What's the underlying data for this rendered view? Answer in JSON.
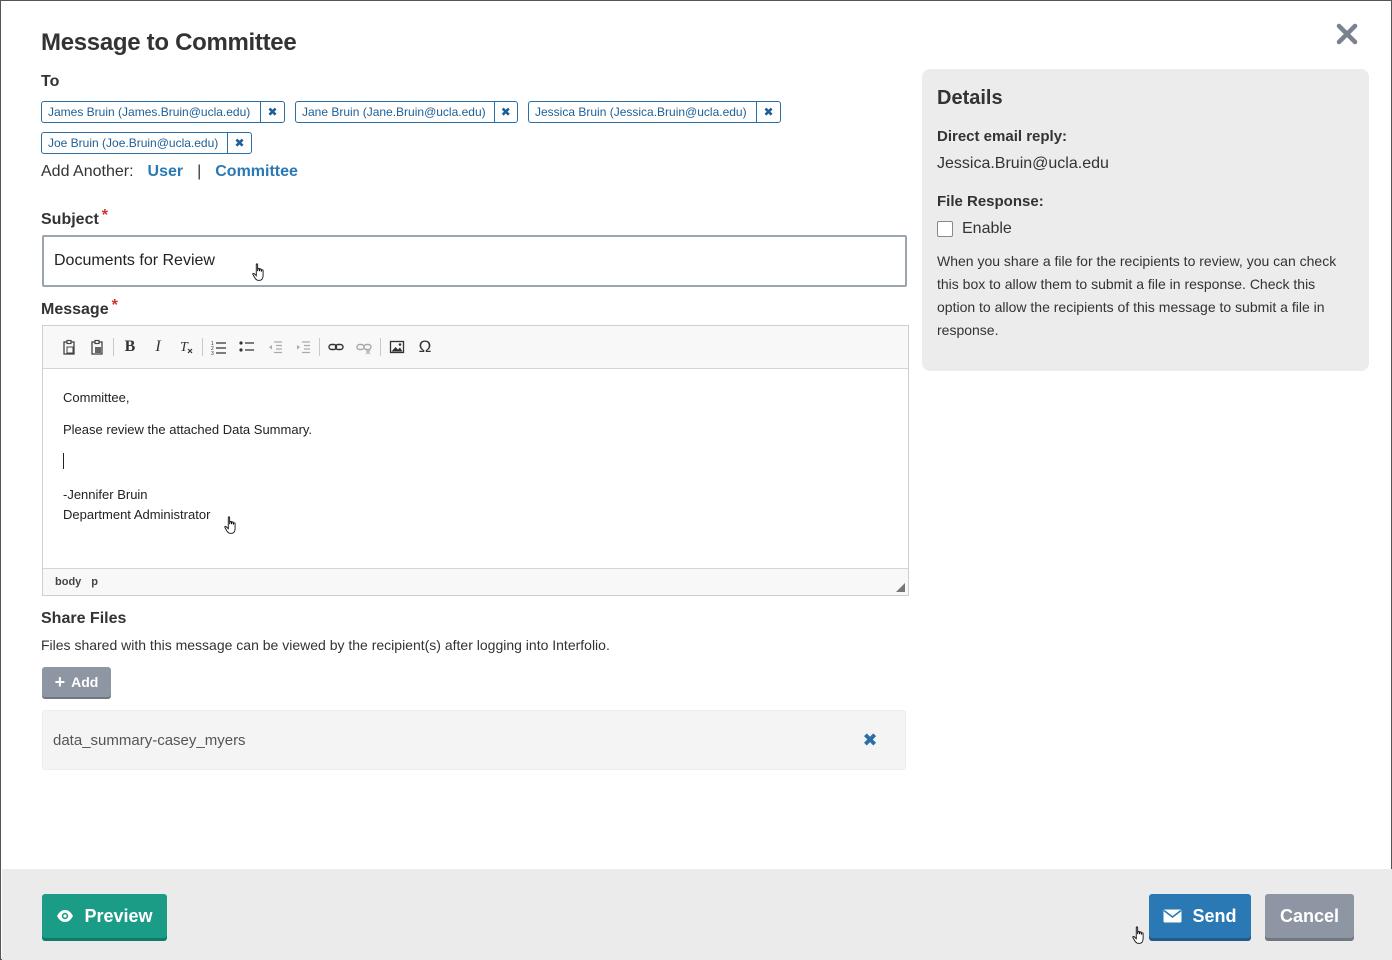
{
  "dialog": {
    "title": "Message to Committee",
    "close_icon": "close-icon"
  },
  "to": {
    "label": "To",
    "recipients": [
      {
        "text": "James Bruin (James.Bruin@ucla.edu)"
      },
      {
        "text": "Jane Bruin (Jane.Bruin@ucla.edu)"
      },
      {
        "text": "Jessica Bruin (Jessica.Bruin@ucla.edu)"
      },
      {
        "text": "Joe Bruin (Joe.Bruin@ucla.edu)"
      }
    ],
    "remove_glyph": "✖",
    "add_another_label": "Add Another:",
    "add_user_link": "User",
    "separator": "|",
    "add_committee_link": "Committee"
  },
  "subject": {
    "label": "Subject",
    "required_mark": "*",
    "value": "Documents for Review"
  },
  "message": {
    "label": "Message",
    "required_mark": "*",
    "lines": {
      "greeting": "Committee,",
      "body": "Please review the attached Data Summary.",
      "signature_name": "-Jennifer Bruin",
      "signature_title": "Department Administrator"
    },
    "statusbar": [
      "body",
      "p"
    ],
    "toolbar_icons": [
      "paste-icon",
      "paste-word-icon",
      "bold-icon",
      "italic-icon",
      "remove-format-icon",
      "numbered-list-icon",
      "bulleted-list-icon",
      "outdent-icon",
      "indent-icon",
      "link-icon",
      "unlink-icon",
      "image-icon",
      "special-char-icon"
    ]
  },
  "share_files": {
    "title": "Share Files",
    "description": "Files shared with this message can be viewed by the recipient(s) after logging into Interfolio.",
    "add_button": "Add",
    "files": [
      {
        "name": "data_summary-casey_myers"
      }
    ]
  },
  "details": {
    "title": "Details",
    "direct_reply_label": "Direct email reply:",
    "direct_reply_value": "Jessica.Bruin@ucla.edu",
    "file_response_label": "File Response:",
    "enable_label": "Enable",
    "enable_checked": false,
    "help_text": "When you share a file for the recipients to review, you can check this box to allow them to submit a file in response. Check this option to allow the recipients of this message to submit a file in response."
  },
  "footer": {
    "preview_button": "Preview",
    "send_button": "Send",
    "cancel_button": "Cancel"
  },
  "colors": {
    "accent_blue": "#2a79b5",
    "preview_green": "#1a9c86",
    "cancel_gray": "#8d96a2",
    "required_red": "#d0312d"
  }
}
